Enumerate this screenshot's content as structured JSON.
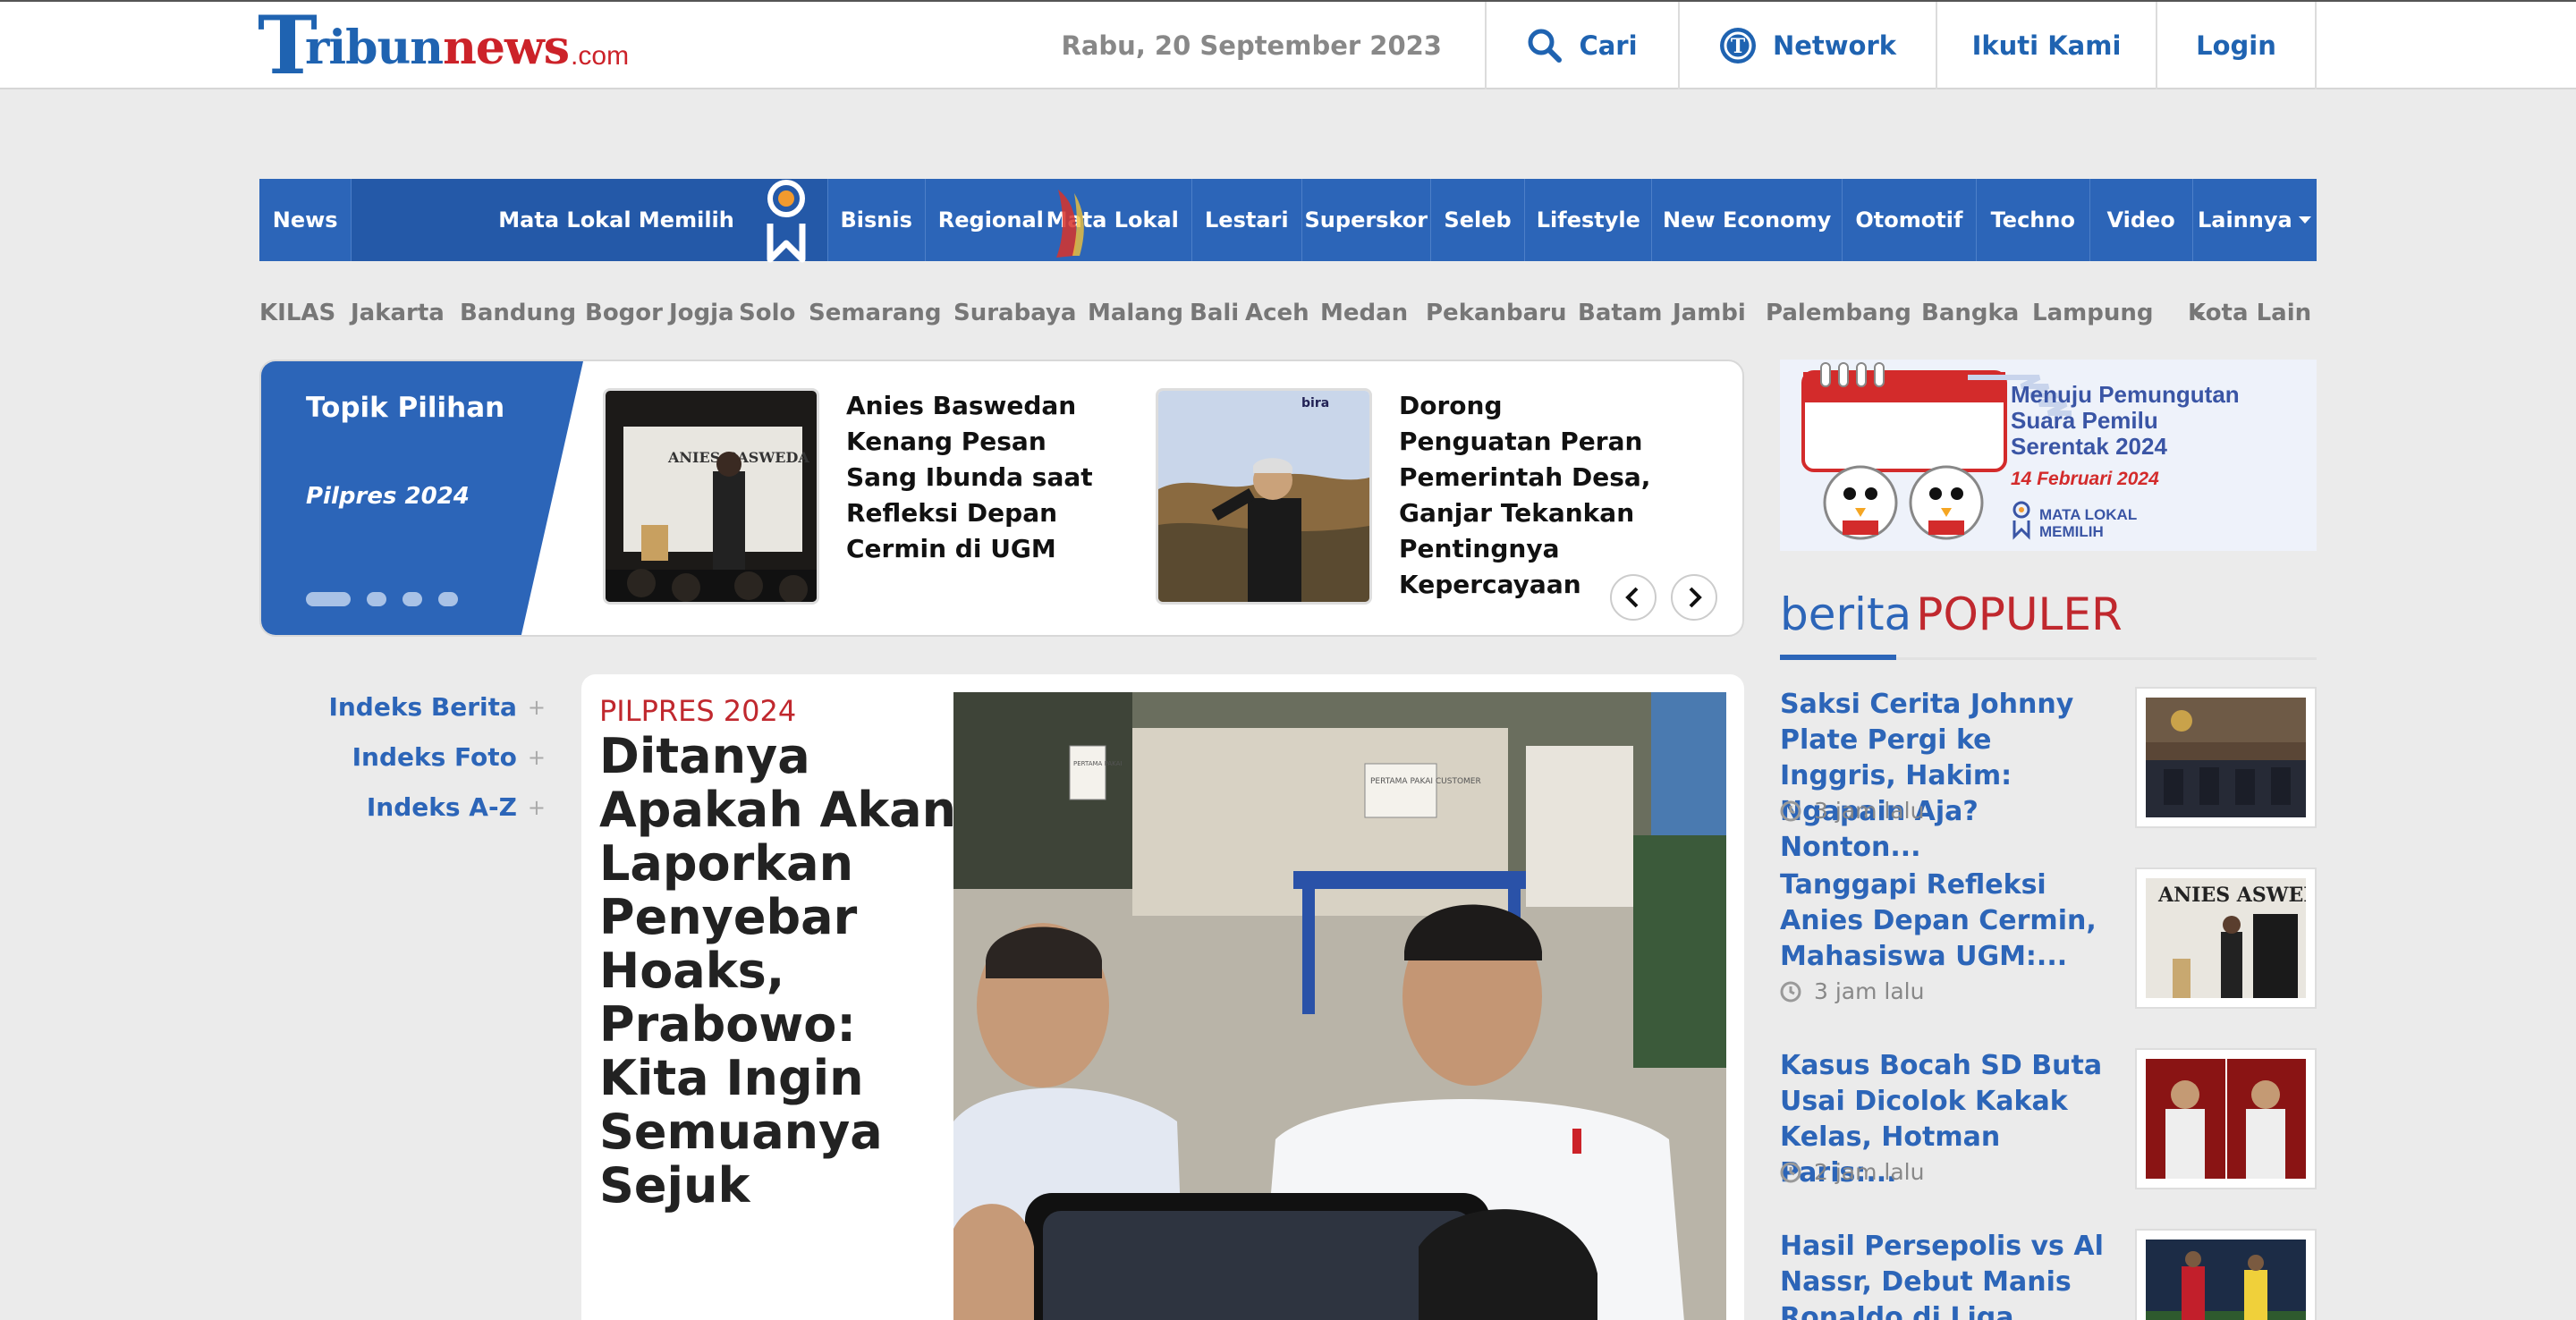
{
  "header": {
    "logo": {
      "t": "T",
      "tribun": "ribun",
      "news": "news",
      "com": ".com"
    },
    "date": "Rabu, 20 September 2023",
    "links": [
      {
        "label": "Cari",
        "icon": "search-icon"
      },
      {
        "label": "Network",
        "icon": "network-icon"
      },
      {
        "label": "Ikuti Kami"
      },
      {
        "label": "Login"
      }
    ]
  },
  "nav": {
    "items": [
      "News",
      "Mata Lokal Memilih",
      "Bisnis",
      "Regional",
      "Mata Lokal",
      "Lestari",
      "Superskor",
      "Seleb",
      "Lifestyle",
      "New Economy",
      "Otomotif",
      "Techno",
      "Video",
      "Lainnya"
    ]
  },
  "cities": [
    "KILAS",
    "Jakarta",
    "Bandung",
    "Bogor",
    "Jogja",
    "Solo",
    "Semarang",
    "Surabaya",
    "Malang",
    "Bali",
    "Aceh",
    "Medan",
    "Pekanbaru",
    "Batam",
    "Jambi",
    "Palembang",
    "Bangka",
    "Lampung",
    "Kota Lain"
  ],
  "topik": {
    "title": "Topik Pilihan",
    "subtitle": "Pilpres 2024",
    "cards": [
      {
        "title": "Anies Baswedan Kenang Pesan Sang Ibunda saat Refleksi Depan Cermin di UGM",
        "img_text": "ANIES BASWEDA"
      },
      {
        "title": "Dorong Penguatan Peran Pemerintah Desa, Ganjar Tekankan Pentingnya Kepercayaan",
        "img_text": "bira"
      }
    ]
  },
  "banner": {
    "line1": "Menuju Pemungutan",
    "line2": "Suara Pemilu",
    "line3": "Serentak 2024",
    "date": "14 Februari 2024",
    "brand1": "MATA LOKAL",
    "brand2": "MEMILIH"
  },
  "populer": {
    "head1": "berita",
    "head2": "POPULER",
    "items": [
      {
        "title": "Saksi Cerita Johnny Plate Pergi ke Inggris, Hakim: Ngapain Aja? Nonton...",
        "time": "3 jam lalu"
      },
      {
        "title": "Tanggapi Refleksi Anies Depan Cermin, Mahasiswa UGM:...",
        "time": "3 jam lalu",
        "img_text": "ANIES ASWEDA"
      },
      {
        "title": "Kasus Bocah SD Buta Usai Dicolok Kakak Kelas, Hotman Paris:...",
        "time": "2 jam lalu"
      },
      {
        "title": "Hasil Persepolis vs Al Nassr, Debut Manis Ronaldo di Liga...",
        "time": ""
      }
    ]
  },
  "indeks": [
    "Indeks Berita",
    "Indeks Foto",
    "Indeks A-Z"
  ],
  "headline": {
    "category": "PILPRES 2024",
    "title": "Ditanya Apakah Akan Laporkan Penyebar Hoaks, Prabowo: Kita Ingin Semuanya Sejuk",
    "img_sign1": "PERTAMA PAKAI",
    "img_sign2": "PERTAMA PAKAI CUSTOMER"
  },
  "colors": {
    "brand_blue": "#2c65b8",
    "brand_red": "#c0282e",
    "page_bg": "#ebebeb"
  }
}
